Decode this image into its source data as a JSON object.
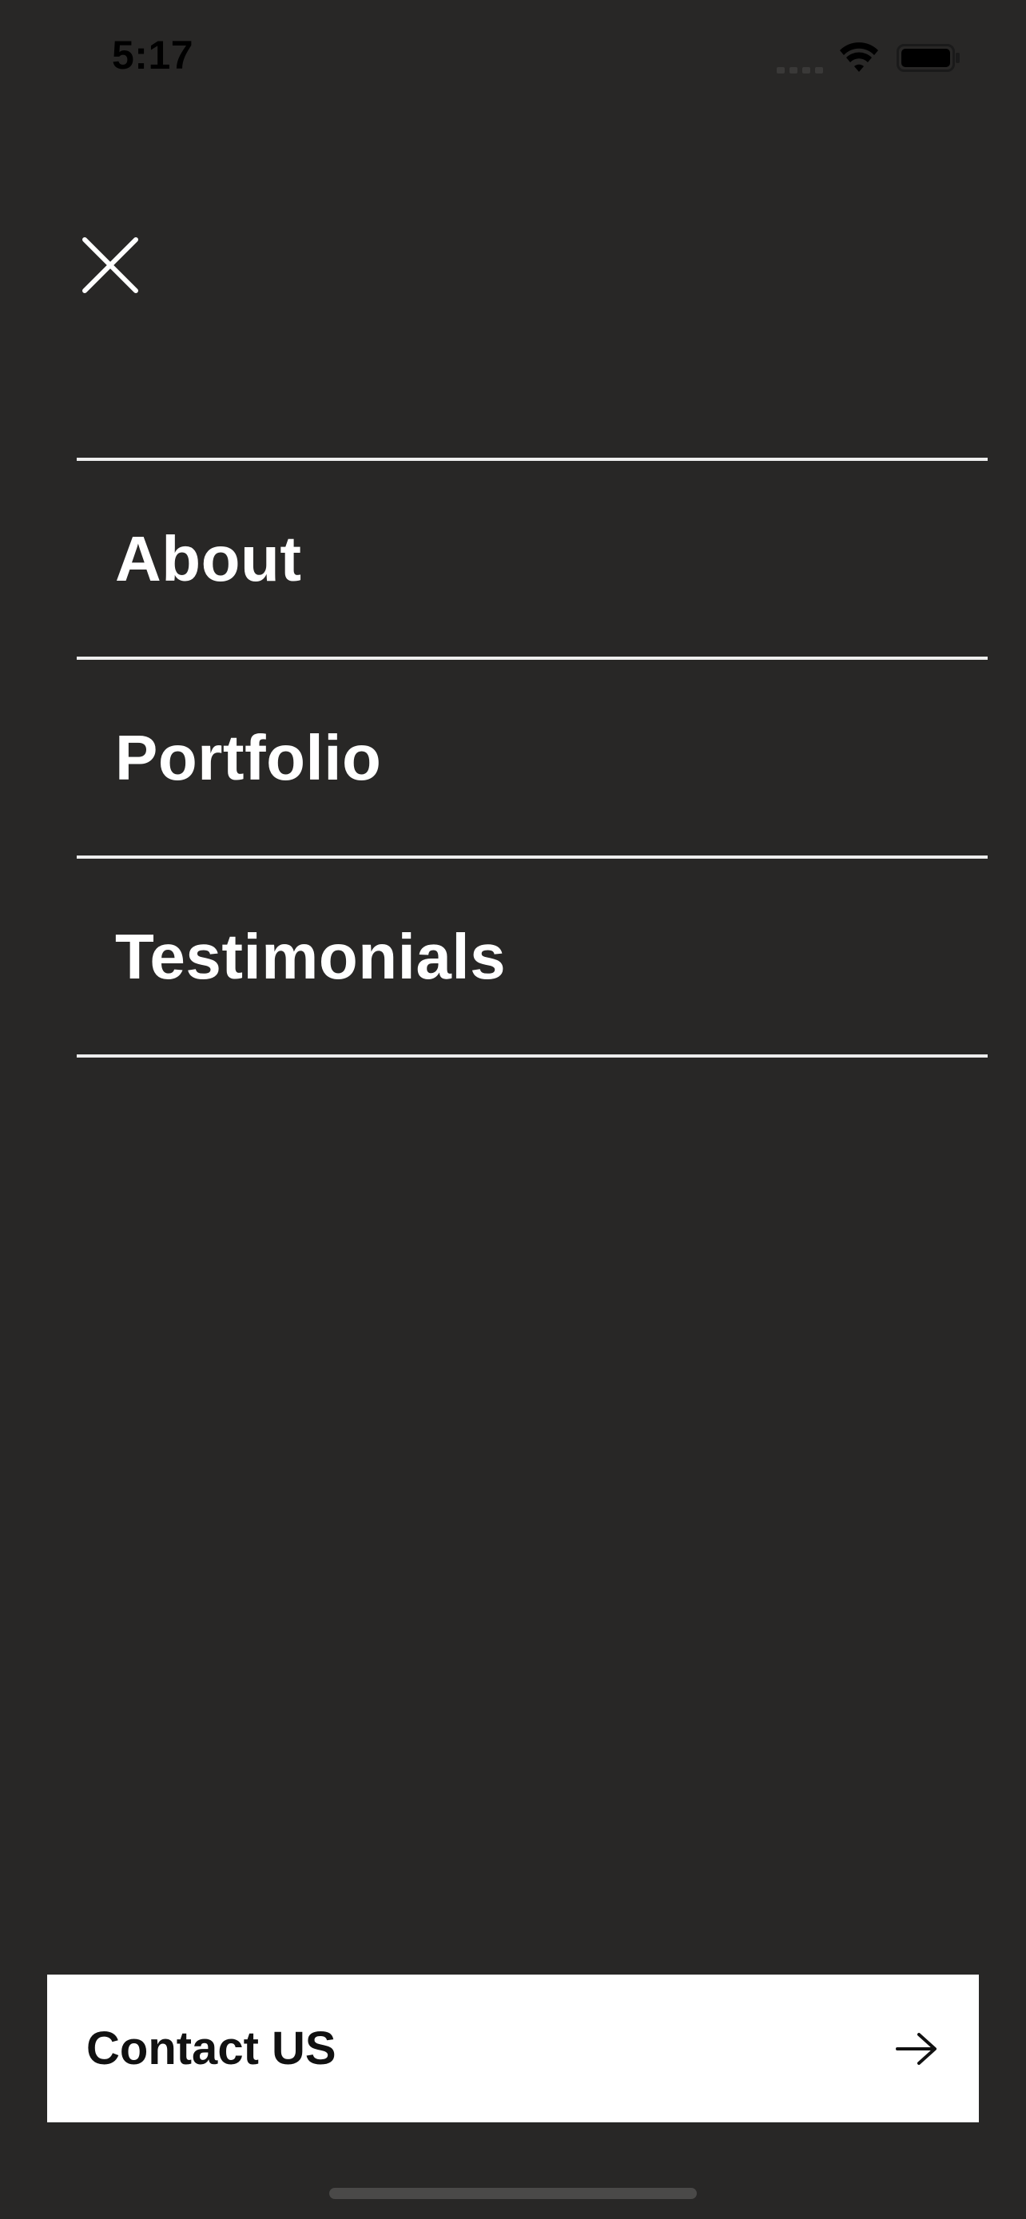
{
  "status_bar": {
    "time": "5:17"
  },
  "icons": {
    "close": "close-icon",
    "wifi": "wifi-icon",
    "battery": "battery-icon",
    "signal": "signal-icon",
    "arrow": "arrow-right-icon"
  },
  "menu": {
    "items": [
      {
        "label": "About"
      },
      {
        "label": "Portfolio"
      },
      {
        "label": "Testimonials"
      }
    ]
  },
  "contact": {
    "label": "Contact US"
  },
  "colors": {
    "background": "#282726",
    "divider": "#eeeeee",
    "text": "#ffffff",
    "button_bg": "#ffffff",
    "button_text": "#111111"
  }
}
